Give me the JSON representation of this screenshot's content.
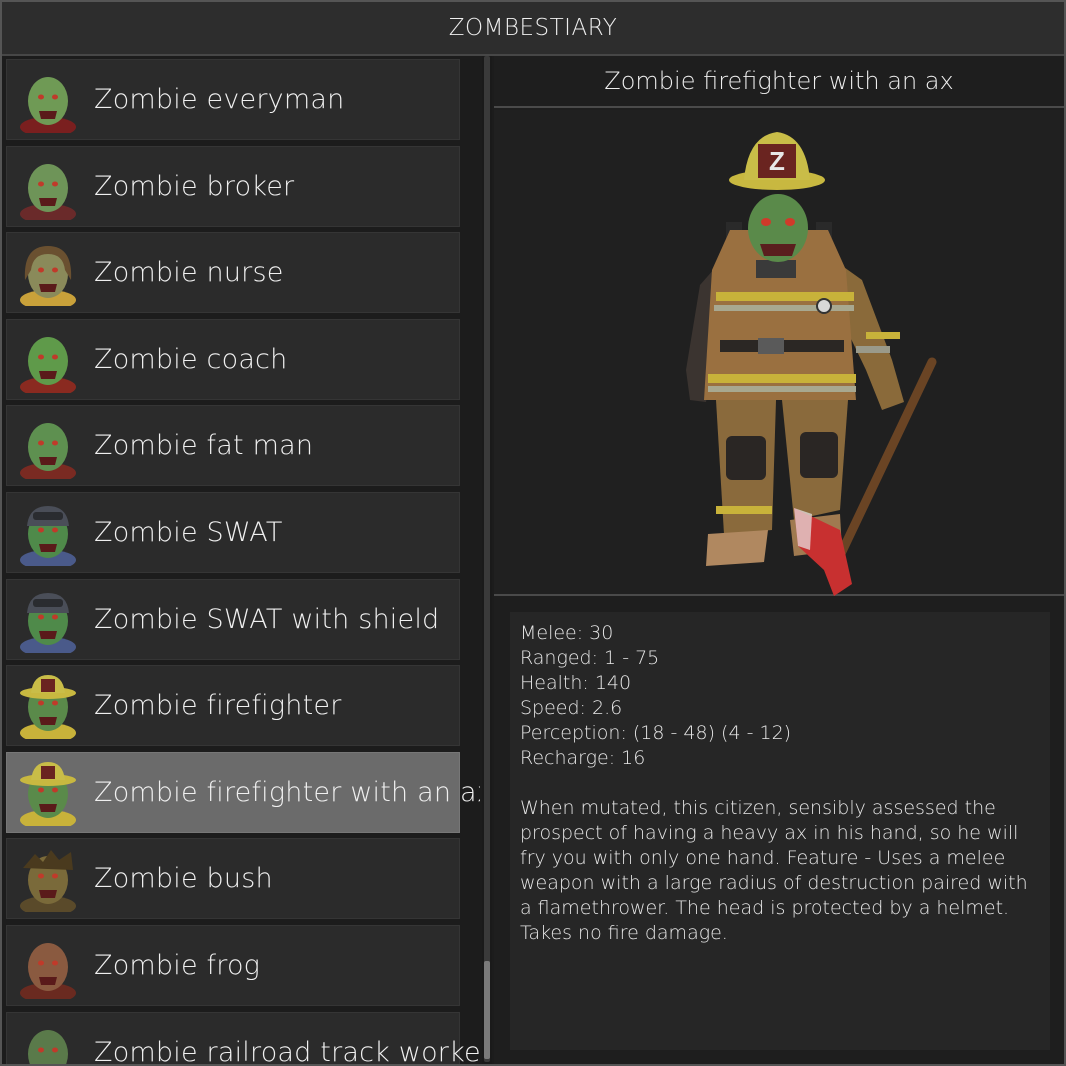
{
  "window": {
    "title": "ZOMBESTIARY"
  },
  "list": {
    "items": [
      {
        "label": "Zombie everyman",
        "icon": "zombie-everyman-portrait-icon",
        "skin": "#6f9a55",
        "accent": "#7a1f1f",
        "hat": "none"
      },
      {
        "label": "Zombie broker",
        "icon": "zombie-broker-portrait-icon",
        "skin": "#6e9458",
        "accent": "#6a2a2a",
        "hat": "none"
      },
      {
        "label": "Zombie nurse",
        "icon": "zombie-nurse-portrait-icon",
        "skin": "#8a8a5a",
        "accent": "#c9a13a",
        "hat": "hair"
      },
      {
        "label": "Zombie coach",
        "icon": "zombie-coach-portrait-icon",
        "skin": "#5f9a4a",
        "accent": "#8a2a20",
        "hat": "none"
      },
      {
        "label": "Zombie fat man",
        "icon": "zombie-fat-man-portrait-icon",
        "skin": "#5e9050",
        "accent": "#7a2a22",
        "hat": "none"
      },
      {
        "label": "Zombie SWAT",
        "icon": "zombie-swat-portrait-icon",
        "skin": "#4f8a4a",
        "accent": "#4a5a8a",
        "hat": "helmet"
      },
      {
        "label": "Zombie SWAT with shield",
        "icon": "zombie-swat-shield-portrait-icon",
        "skin": "#4f8a4a",
        "accent": "#4a5a8a",
        "hat": "helmet"
      },
      {
        "label": "Zombie firefighter",
        "icon": "zombie-firefighter-portrait-icon",
        "skin": "#5a8a4a",
        "accent": "#c8b23a",
        "hat": "fire"
      },
      {
        "label": "Zombie firefighter with an ax",
        "icon": "zombie-firefighter-ax-portrait-icon",
        "skin": "#5a8a4a",
        "accent": "#c8b23a",
        "hat": "fire"
      },
      {
        "label": "Zombie bush",
        "icon": "zombie-bush-portrait-icon",
        "skin": "#7a6a3a",
        "accent": "#5a4a2a",
        "hat": "bush"
      },
      {
        "label": "Zombie frog",
        "icon": "zombie-frog-portrait-icon",
        "skin": "#8a5a40",
        "accent": "#6a2a20",
        "hat": "none"
      },
      {
        "label": "Zombie railroad track worker",
        "icon": "zombie-railroad-worker-portrait-icon",
        "skin": "#5a7a4a",
        "accent": "#3a3a3a",
        "hat": "none"
      }
    ],
    "selected_index": 8
  },
  "detail": {
    "title": "Zombie firefighter with an ax",
    "portrait_icon": "zombie-firefighter-with-ax-full-body",
    "stats": [
      "Melee: 30",
      "Ranged: 1 - 75",
      "Health: 140",
      "Speed: 2.6",
      "Perception: (18 - 48) (4 - 12)",
      "Recharge: 16"
    ],
    "description": "When mutated, this citizen, sensibly assessed the\nprospect of having a heavy ax in his hand, so he will\nfry you with only one hand. Feature - Uses a melee\nweapon with a large radius of destruction paired with\na flamethrower. The head is protected by a helmet.\nTakes no fire damage.",
    "helmet_badge": "Z"
  },
  "scroll": {
    "position_fraction": 0.9
  },
  "colors": {
    "selected_row": "#6b6b6b",
    "row": "#2b2b2b",
    "titlebar": "#2d2d2d"
  }
}
